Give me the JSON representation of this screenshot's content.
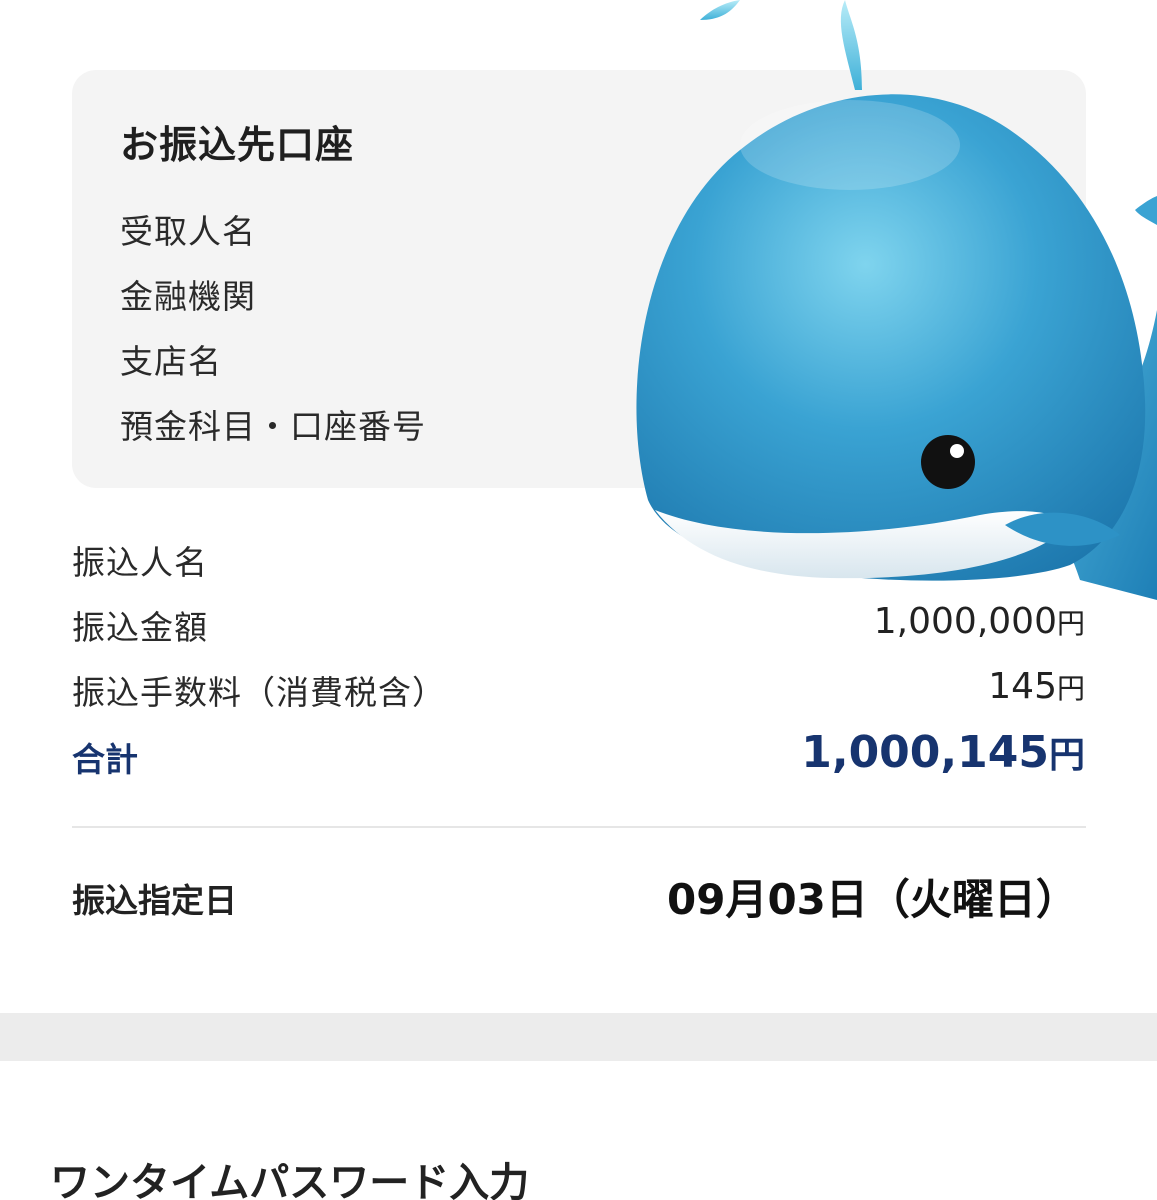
{
  "account_section": {
    "title": "お振込先口座",
    "fields": [
      "受取人名",
      "金融機関",
      "支店名",
      "預金科目・口座番号"
    ]
  },
  "transfer": {
    "sender_label": "振込人名",
    "amount_label": "振込金額",
    "amount_value": "1,000,000",
    "fee_label": "振込手数料（消費税含）",
    "fee_value": "145",
    "total_label": "合計",
    "total_value": "1,000,145",
    "currency": "円"
  },
  "schedule": {
    "label": "振込指定日",
    "value": "09月03日（火曜日）"
  },
  "otp": {
    "title": "ワンタイムパスワード入力"
  },
  "sticker": {
    "icon": "whale-emoji-icon"
  },
  "colors": {
    "accent": "#17346f",
    "card_background": "#f4f4f4",
    "whale_body": "#2a8fc4"
  }
}
